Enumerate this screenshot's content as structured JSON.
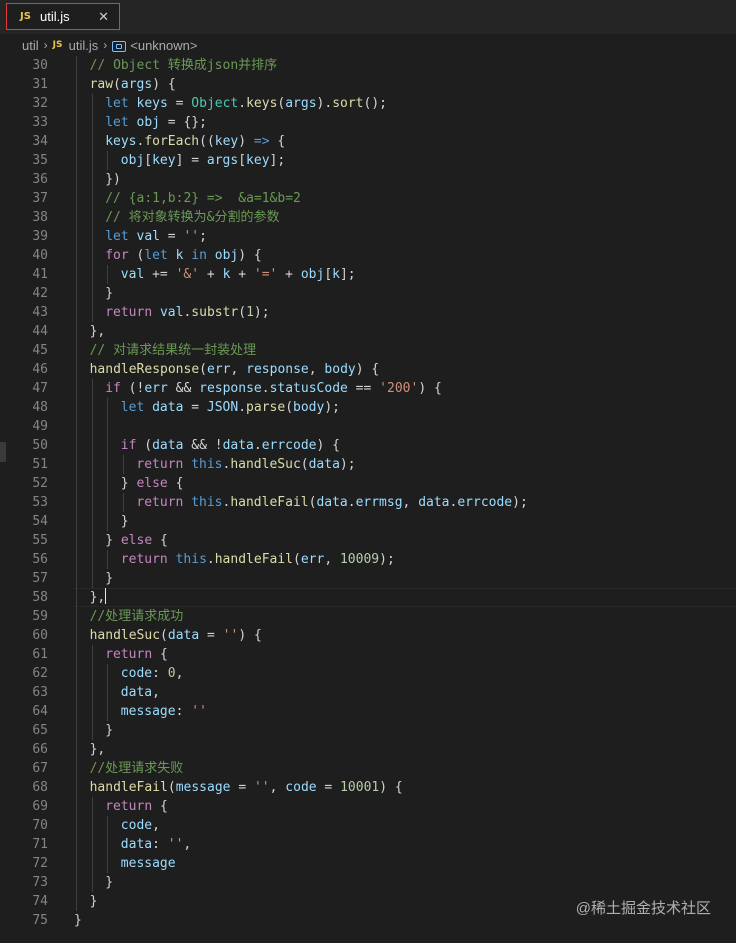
{
  "tab": {
    "icon_label": "JS",
    "filename": "util.js",
    "close": "✕"
  },
  "breadcrumb": {
    "folder": "util",
    "file_icon_label": "JS",
    "file": "util.js",
    "symbol": "<unknown>"
  },
  "colors": {
    "keyword": "#569cd6",
    "control": "#c586c0",
    "function": "#dcdcaa",
    "variable": "#9cdcfe",
    "class": "#4ec9b0",
    "string": "#ce9178",
    "number": "#b5cea8",
    "comment": "#6a9955",
    "text": "#d4d4d4"
  },
  "lines": [
    {
      "n": "30",
      "indent": 1,
      "tokens": [
        [
          "// Object 转换成json并排序",
          "comment"
        ]
      ]
    },
    {
      "n": "31",
      "indent": 1,
      "tokens": [
        [
          "raw",
          "function"
        ],
        [
          "(",
          "text"
        ],
        [
          "args",
          "variable"
        ],
        [
          ") {",
          "text"
        ]
      ]
    },
    {
      "n": "32",
      "indent": 2,
      "tokens": [
        [
          "let",
          "keyword"
        ],
        [
          " ",
          "text"
        ],
        [
          "keys",
          "variable"
        ],
        [
          " = ",
          "text"
        ],
        [
          "Object",
          "class"
        ],
        [
          ".",
          "text"
        ],
        [
          "keys",
          "function"
        ],
        [
          "(",
          "text"
        ],
        [
          "args",
          "variable"
        ],
        [
          ").",
          "text"
        ],
        [
          "sort",
          "function"
        ],
        [
          "();",
          "text"
        ]
      ]
    },
    {
      "n": "33",
      "indent": 2,
      "tokens": [
        [
          "let",
          "keyword"
        ],
        [
          " ",
          "text"
        ],
        [
          "obj",
          "variable"
        ],
        [
          " = {};",
          "text"
        ]
      ]
    },
    {
      "n": "34",
      "indent": 2,
      "tokens": [
        [
          "keys",
          "variable"
        ],
        [
          ".",
          "text"
        ],
        [
          "forEach",
          "function"
        ],
        [
          "((",
          "text"
        ],
        [
          "key",
          "variable"
        ],
        [
          ") ",
          "text"
        ],
        [
          "=>",
          "keyword"
        ],
        [
          " {",
          "text"
        ]
      ]
    },
    {
      "n": "35",
      "indent": 3,
      "tokens": [
        [
          "obj",
          "variable"
        ],
        [
          "[",
          "text"
        ],
        [
          "key",
          "variable"
        ],
        [
          "] = ",
          "text"
        ],
        [
          "args",
          "variable"
        ],
        [
          "[",
          "text"
        ],
        [
          "key",
          "variable"
        ],
        [
          "];",
          "text"
        ]
      ]
    },
    {
      "n": "36",
      "indent": 2,
      "tokens": [
        [
          "})",
          "text"
        ]
      ]
    },
    {
      "n": "37",
      "indent": 2,
      "tokens": [
        [
          "// {a:1,b:2} =>  &a=1&b=2",
          "comment"
        ]
      ]
    },
    {
      "n": "38",
      "indent": 2,
      "tokens": [
        [
          "// 将对象转换为&分割的参数",
          "comment"
        ]
      ]
    },
    {
      "n": "39",
      "indent": 2,
      "tokens": [
        [
          "let",
          "keyword"
        ],
        [
          " ",
          "text"
        ],
        [
          "val",
          "variable"
        ],
        [
          " = ",
          "text"
        ],
        [
          "''",
          "string"
        ],
        [
          ";",
          "text"
        ]
      ]
    },
    {
      "n": "40",
      "indent": 2,
      "tokens": [
        [
          "for",
          "control"
        ],
        [
          " (",
          "text"
        ],
        [
          "let",
          "keyword"
        ],
        [
          " ",
          "text"
        ],
        [
          "k",
          "variable"
        ],
        [
          " ",
          "text"
        ],
        [
          "in",
          "keyword"
        ],
        [
          " ",
          "text"
        ],
        [
          "obj",
          "variable"
        ],
        [
          ") {",
          "text"
        ]
      ]
    },
    {
      "n": "41",
      "indent": 3,
      "tokens": [
        [
          "val",
          "variable"
        ],
        [
          " += ",
          "text"
        ],
        [
          "'&'",
          "string"
        ],
        [
          " + ",
          "text"
        ],
        [
          "k",
          "variable"
        ],
        [
          " + ",
          "text"
        ],
        [
          "'='",
          "string"
        ],
        [
          " + ",
          "text"
        ],
        [
          "obj",
          "variable"
        ],
        [
          "[",
          "text"
        ],
        [
          "k",
          "variable"
        ],
        [
          "];",
          "text"
        ]
      ]
    },
    {
      "n": "42",
      "indent": 2,
      "tokens": [
        [
          "}",
          "text"
        ]
      ]
    },
    {
      "n": "43",
      "indent": 2,
      "tokens": [
        [
          "return",
          "control"
        ],
        [
          " ",
          "text"
        ],
        [
          "val",
          "variable"
        ],
        [
          ".",
          "text"
        ],
        [
          "substr",
          "function"
        ],
        [
          "(",
          "text"
        ],
        [
          "1",
          "number"
        ],
        [
          ");",
          "text"
        ]
      ]
    },
    {
      "n": "44",
      "indent": 1,
      "tokens": [
        [
          "},",
          "text"
        ]
      ]
    },
    {
      "n": "45",
      "indent": 1,
      "tokens": [
        [
          "// 对请求结果统一封装处理",
          "comment"
        ]
      ]
    },
    {
      "n": "46",
      "indent": 1,
      "tokens": [
        [
          "handleResponse",
          "function"
        ],
        [
          "(",
          "text"
        ],
        [
          "err",
          "variable"
        ],
        [
          ", ",
          "text"
        ],
        [
          "response",
          "variable"
        ],
        [
          ", ",
          "text"
        ],
        [
          "body",
          "variable"
        ],
        [
          ") {",
          "text"
        ]
      ]
    },
    {
      "n": "47",
      "indent": 2,
      "tokens": [
        [
          "if",
          "control"
        ],
        [
          " (!",
          "text"
        ],
        [
          "err",
          "variable"
        ],
        [
          " && ",
          "text"
        ],
        [
          "response",
          "variable"
        ],
        [
          ".",
          "text"
        ],
        [
          "statusCode",
          "variable"
        ],
        [
          " == ",
          "text"
        ],
        [
          "'200'",
          "string"
        ],
        [
          ") {",
          "text"
        ]
      ]
    },
    {
      "n": "48",
      "indent": 3,
      "tokens": [
        [
          "let",
          "keyword"
        ],
        [
          " ",
          "text"
        ],
        [
          "data",
          "variable"
        ],
        [
          " = ",
          "text"
        ],
        [
          "JSON",
          "variable"
        ],
        [
          ".",
          "text"
        ],
        [
          "parse",
          "function"
        ],
        [
          "(",
          "text"
        ],
        [
          "body",
          "variable"
        ],
        [
          ");",
          "text"
        ]
      ]
    },
    {
      "n": "49",
      "indent": 3,
      "tokens": []
    },
    {
      "n": "50",
      "indent": 3,
      "tokens": [
        [
          "if",
          "control"
        ],
        [
          " (",
          "text"
        ],
        [
          "data",
          "variable"
        ],
        [
          " && !",
          "text"
        ],
        [
          "data",
          "variable"
        ],
        [
          ".",
          "text"
        ],
        [
          "errcode",
          "variable"
        ],
        [
          ") {",
          "text"
        ]
      ]
    },
    {
      "n": "51",
      "indent": 4,
      "tokens": [
        [
          "return",
          "control"
        ],
        [
          " ",
          "text"
        ],
        [
          "this",
          "keyword"
        ],
        [
          ".",
          "text"
        ],
        [
          "handleSuc",
          "function"
        ],
        [
          "(",
          "text"
        ],
        [
          "data",
          "variable"
        ],
        [
          ");",
          "text"
        ]
      ]
    },
    {
      "n": "52",
      "indent": 3,
      "tokens": [
        [
          "} ",
          "text"
        ],
        [
          "else",
          "control"
        ],
        [
          " {",
          "text"
        ]
      ]
    },
    {
      "n": "53",
      "indent": 4,
      "tokens": [
        [
          "return",
          "control"
        ],
        [
          " ",
          "text"
        ],
        [
          "this",
          "keyword"
        ],
        [
          ".",
          "text"
        ],
        [
          "handleFail",
          "function"
        ],
        [
          "(",
          "text"
        ],
        [
          "data",
          "variable"
        ],
        [
          ".",
          "text"
        ],
        [
          "errmsg",
          "variable"
        ],
        [
          ", ",
          "text"
        ],
        [
          "data",
          "variable"
        ],
        [
          ".",
          "text"
        ],
        [
          "errcode",
          "variable"
        ],
        [
          ");",
          "text"
        ]
      ]
    },
    {
      "n": "54",
      "indent": 3,
      "tokens": [
        [
          "}",
          "text"
        ]
      ]
    },
    {
      "n": "55",
      "indent": 2,
      "tokens": [
        [
          "} ",
          "text"
        ],
        [
          "else",
          "control"
        ],
        [
          " {",
          "text"
        ]
      ]
    },
    {
      "n": "56",
      "indent": 3,
      "tokens": [
        [
          "return",
          "control"
        ],
        [
          " ",
          "text"
        ],
        [
          "this",
          "keyword"
        ],
        [
          ".",
          "text"
        ],
        [
          "handleFail",
          "function"
        ],
        [
          "(",
          "text"
        ],
        [
          "err",
          "variable"
        ],
        [
          ", ",
          "text"
        ],
        [
          "10009",
          "number"
        ],
        [
          ");",
          "text"
        ]
      ]
    },
    {
      "n": "57",
      "indent": 2,
      "tokens": [
        [
          "}",
          "text"
        ]
      ]
    },
    {
      "n": "58",
      "indent": 1,
      "tokens": [
        [
          "},",
          "text"
        ]
      ]
    },
    {
      "n": "59",
      "indent": 1,
      "tokens": [
        [
          "//处理请求成功",
          "comment"
        ]
      ]
    },
    {
      "n": "60",
      "indent": 1,
      "tokens": [
        [
          "handleSuc",
          "function"
        ],
        [
          "(",
          "text"
        ],
        [
          "data",
          "variable"
        ],
        [
          " = ",
          "text"
        ],
        [
          "''",
          "string"
        ],
        [
          ") {",
          "text"
        ]
      ]
    },
    {
      "n": "61",
      "indent": 2,
      "tokens": [
        [
          "return",
          "control"
        ],
        [
          " {",
          "text"
        ]
      ]
    },
    {
      "n": "62",
      "indent": 3,
      "tokens": [
        [
          "code",
          "variable"
        ],
        [
          ": ",
          "text"
        ],
        [
          "0",
          "number"
        ],
        [
          ",",
          "text"
        ]
      ]
    },
    {
      "n": "63",
      "indent": 3,
      "tokens": [
        [
          "data",
          "variable"
        ],
        [
          ",",
          "text"
        ]
      ]
    },
    {
      "n": "64",
      "indent": 3,
      "tokens": [
        [
          "message",
          "variable"
        ],
        [
          ": ",
          "text"
        ],
        [
          "''",
          "string"
        ]
      ]
    },
    {
      "n": "65",
      "indent": 2,
      "tokens": [
        [
          "}",
          "text"
        ]
      ]
    },
    {
      "n": "66",
      "indent": 1,
      "tokens": [
        [
          "},",
          "text"
        ]
      ]
    },
    {
      "n": "67",
      "indent": 1,
      "tokens": [
        [
          "//处理请求失败",
          "comment"
        ]
      ]
    },
    {
      "n": "68",
      "indent": 1,
      "tokens": [
        [
          "handleFail",
          "function"
        ],
        [
          "(",
          "text"
        ],
        [
          "message",
          "variable"
        ],
        [
          " = ",
          "text"
        ],
        [
          "''",
          "string"
        ],
        [
          ", ",
          "text"
        ],
        [
          "code",
          "variable"
        ],
        [
          " = ",
          "text"
        ],
        [
          "10001",
          "number"
        ],
        [
          ") {",
          "text"
        ]
      ]
    },
    {
      "n": "69",
      "indent": 2,
      "tokens": [
        [
          "return",
          "control"
        ],
        [
          " {",
          "text"
        ]
      ]
    },
    {
      "n": "70",
      "indent": 3,
      "tokens": [
        [
          "code",
          "variable"
        ],
        [
          ",",
          "text"
        ]
      ]
    },
    {
      "n": "71",
      "indent": 3,
      "tokens": [
        [
          "data",
          "variable"
        ],
        [
          ": ",
          "text"
        ],
        [
          "''",
          "string"
        ],
        [
          ",",
          "text"
        ]
      ]
    },
    {
      "n": "72",
      "indent": 3,
      "tokens": [
        [
          "message",
          "variable"
        ]
      ]
    },
    {
      "n": "73",
      "indent": 2,
      "tokens": [
        [
          "}",
          "text"
        ]
      ]
    },
    {
      "n": "74",
      "indent": 1,
      "tokens": [
        [
          "}",
          "text"
        ]
      ]
    },
    {
      "n": "75",
      "indent": 0,
      "tokens": [
        [
          "}",
          "text"
        ]
      ]
    }
  ],
  "watermark": "@稀土掘金技术社区"
}
